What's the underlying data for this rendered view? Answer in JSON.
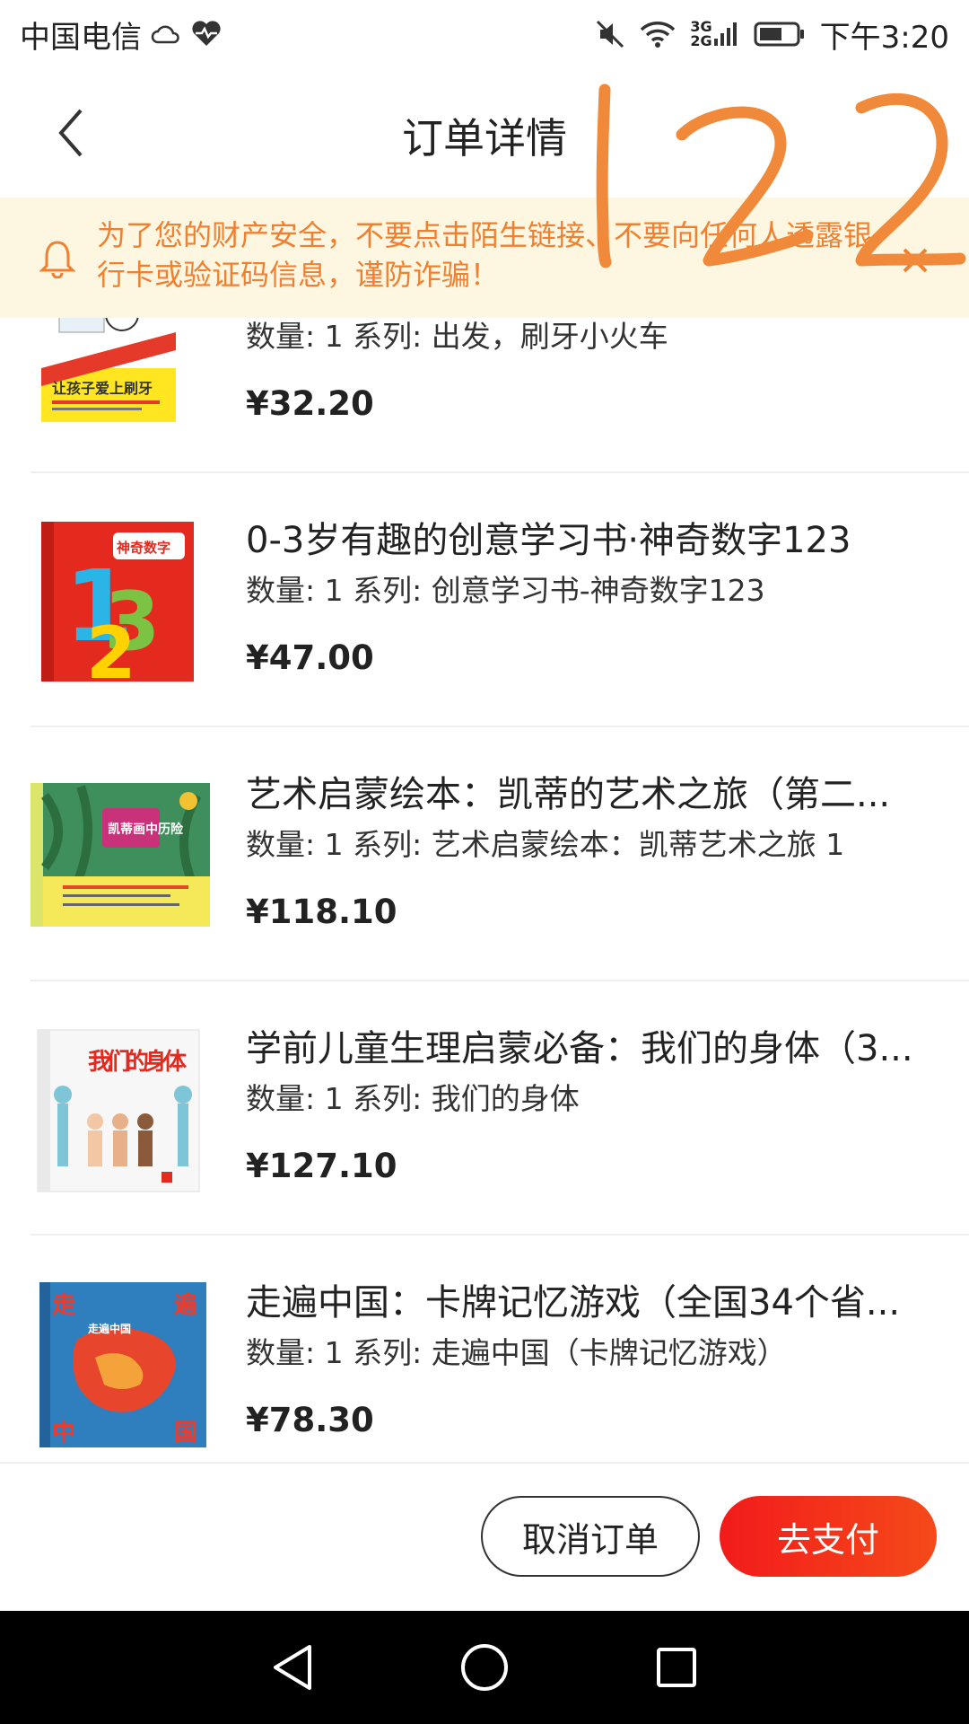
{
  "status_bar": {
    "carrier": "中国电信",
    "network": [
      "3G",
      "2G"
    ],
    "time": "下午3:20",
    "icons": [
      "cloud-icon",
      "heart-pulse-icon",
      "mute-icon",
      "wifi-icon",
      "signal-icon",
      "battery-icon"
    ]
  },
  "header": {
    "title": "订单详情",
    "back_icon": "chevron-left-icon",
    "handwritten_annotation": "122"
  },
  "notice": {
    "text": "为了您的财产安全，不要点击陌生链接、不要向任何人透露银行卡或验证码信息，谨防诈骗！",
    "color": "#f08030",
    "background": "#fdf6e0"
  },
  "items": [
    {
      "title": "",
      "spec": "数量: 1 系列: 出发，刷牙小火车",
      "price": "¥32.20",
      "cover_text": "让孩子爱上刷牙"
    },
    {
      "title": "0-3岁有趣的创意学习书·神奇数字123",
      "spec": "数量: 1 系列: 创意学习书-神奇数字123",
      "price": "¥47.00",
      "cover_text": "神奇数字"
    },
    {
      "title": "艺术启蒙绘本：凯蒂的艺术之旅（第二...",
      "spec": "数量: 1 系列: 艺术启蒙绘本：凯蒂艺术之旅 1",
      "price": "¥118.10",
      "cover_text": "凯蒂画中历险"
    },
    {
      "title": "学前儿童生理启蒙必备：我们的身体（3...",
      "spec": "数量: 1 系列: 我们的身体",
      "price": "¥127.10",
      "cover_text": "我们的身体"
    },
    {
      "title": "走遍中国：卡牌记忆游戏（全国34个省...",
      "spec": "数量: 1 系列: 走遍中国（卡牌记忆游戏）",
      "price": "¥78.30",
      "cover_text": "走遍中国"
    }
  ],
  "actions": {
    "cancel_label": "取消订单",
    "pay_label": "去支付",
    "pay_color": "#f21b1b"
  },
  "nav": [
    "back-triangle-icon",
    "home-circle-icon",
    "recents-square-icon"
  ]
}
